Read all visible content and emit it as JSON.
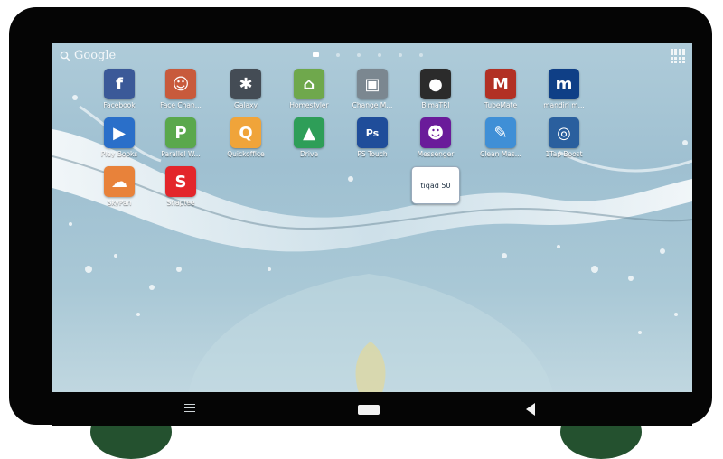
{
  "search": {
    "label": "Google",
    "icon": "search-icon"
  },
  "pages": {
    "count": 6,
    "active": 0
  },
  "apps": [
    {
      "label": "Facebook",
      "icon": "facebook-icon",
      "color": "#3b5998",
      "glyph": "f"
    },
    {
      "label": "Face Chan...",
      "icon": "face-changer-icon",
      "color": "#c85a3c",
      "glyph": "☺"
    },
    {
      "label": "Galaxy",
      "icon": "galaxy-icon",
      "color": "#444c55",
      "glyph": "✱"
    },
    {
      "label": "Homestyler",
      "icon": "homestyler-icon",
      "color": "#6fa84c",
      "glyph": "⌂"
    },
    {
      "label": "Change M...",
      "icon": "change-m-icon",
      "color": "#7b8790",
      "glyph": "▣"
    },
    {
      "label": "BimaTRI",
      "icon": "bimatri-icon",
      "color": "#2b2b2b",
      "glyph": "●"
    },
    {
      "label": "TubeMate",
      "icon": "tubemate-icon",
      "color": "#b23024",
      "glyph": "M"
    },
    {
      "label": "mandiri m...",
      "icon": "mandiri-icon",
      "color": "#0f3f86",
      "glyph": "m"
    },
    {
      "label": "Play Books",
      "icon": "play-books-icon",
      "color": "#2a6fc9",
      "glyph": "▶"
    },
    {
      "label": "Parallel W...",
      "icon": "parallel-w-icon",
      "color": "#5aa84c",
      "glyph": "P"
    },
    {
      "label": "Quickoffice",
      "icon": "quickoffice-icon",
      "color": "#f0a43a",
      "glyph": "Q"
    },
    {
      "label": "Drive",
      "icon": "drive-icon",
      "color": "#2e9e58",
      "glyph": "▲"
    },
    {
      "label": "PS Touch",
      "icon": "ps-touch-icon",
      "color": "#1f4d9a",
      "glyph": "Ps"
    },
    {
      "label": "Messenger",
      "icon": "messenger-icon",
      "color": "#6a1b9a",
      "glyph": "☻"
    },
    {
      "label": "Clean Mas...",
      "icon": "clean-master-icon",
      "color": "#3f8fd6",
      "glyph": "✎"
    },
    {
      "label": "1Tap Boost",
      "icon": "1tap-boost-icon",
      "color": "#2a5f9e",
      "glyph": "◎"
    },
    {
      "label": "SkyPan",
      "icon": "skypan-icon",
      "color": "#e8823a",
      "glyph": "☁"
    },
    {
      "label": "Snaptee",
      "icon": "snaptee-icon",
      "color": "#e3262b",
      "glyph": "S"
    },
    {
      "label": "",
      "widget": "tiqad 50",
      "icon": "tiqad-widget-icon",
      "color": "#ffffff"
    }
  ],
  "navbar": {
    "menu": "menu-icon",
    "home": "home-icon",
    "back": "back-icon"
  }
}
